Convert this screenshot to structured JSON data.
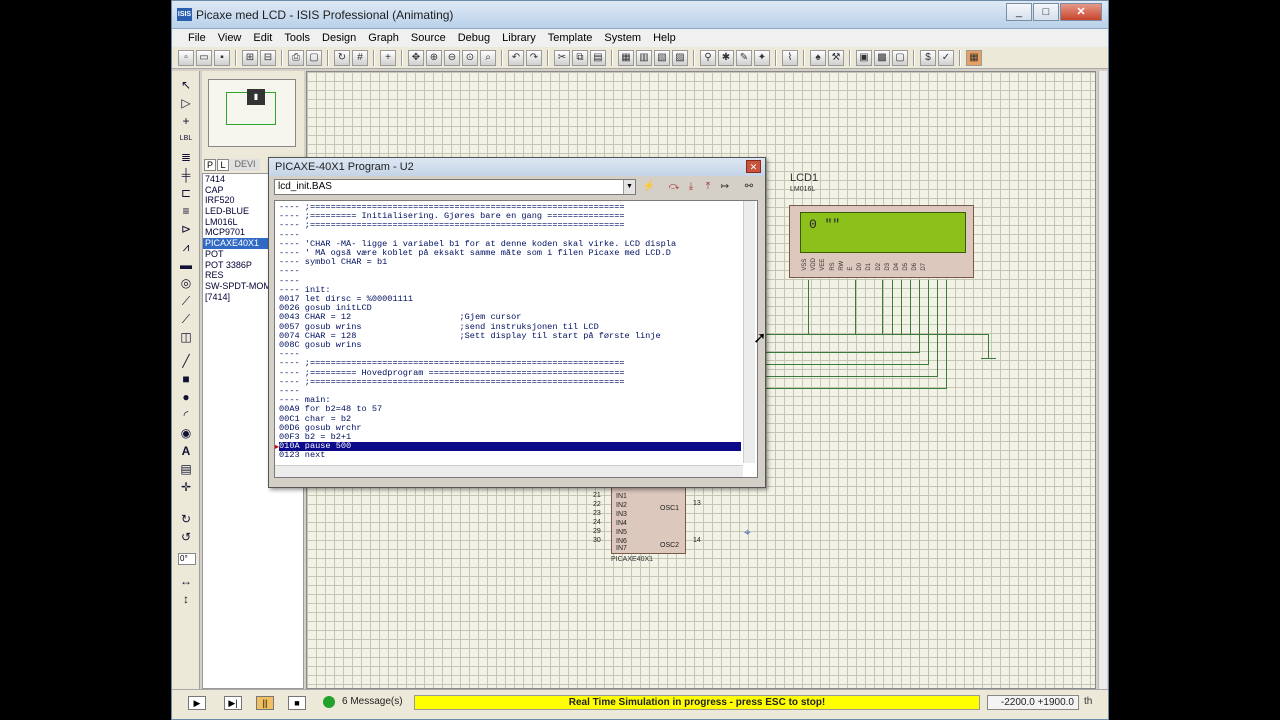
{
  "window": {
    "title": "Picaxe med LCD - ISIS Professional (Animating)",
    "icon": "ISIS"
  },
  "window_buttons": {
    "minimize": "_",
    "maximize": "□",
    "close": "✕"
  },
  "menu": [
    "File",
    "View",
    "Edit",
    "Tools",
    "Design",
    "Graph",
    "Source",
    "Debug",
    "Library",
    "Template",
    "System",
    "Help"
  ],
  "device_panel": {
    "tab_p": "P",
    "tab_l": "L",
    "header": "DEVI",
    "devices": [
      "7414",
      "CAP",
      "IRF520",
      "LED-BLUE",
      "LM016L",
      "MCP9701",
      "PICAXE40X1",
      "POT",
      "POT 3386P",
      "RES",
      "SW-SPDT-MOM",
      "[7414]"
    ],
    "selected": "PICAXE40X1"
  },
  "rotation_field": "0°",
  "program_window": {
    "title": "PICAXE-40X1 Program - U2",
    "file": "lcd_init.BAS",
    "code_lines": [
      "---- ;=============================================================",
      "---- ;========= Initialisering. Gjøres bare en gang ===============",
      "---- ;=============================================================",
      "----",
      "---- 'CHAR -MÅ- ligge i variabel b1 for at denne koden skal virke. LCD displa",
      "---- ' MÅ også være koblet på eksakt samme måte som i filen Picaxe med LCD.D",
      "---- symbol CHAR = b1",
      "----",
      "----",
      "---- init:",
      "0017 let dirsc = %00001111",
      "0026 gosub initLCD",
      "0043 CHAR = 12                     ;Gjem cursor",
      "0057 gosub wrins                   ;send instruksjonen til LCD",
      "0074 CHAR = 128                    ;Sett display til start på første linje",
      "008C gosub wrins",
      "----",
      "---- ;=============================================================",
      "---- ;========= Hovedprogram ======================================",
      "---- ;=============================================================",
      "----",
      "---- main:",
      "00A9 for b2=48 to 57",
      "00C1 char = b2",
      "00D6 gosub wrchr",
      "00F3 b2 = b2+1",
      "010A pause 500",
      "0123 next"
    ],
    "highlighted_line": 26
  },
  "lcd": {
    "label": "LCD1",
    "model": "LM016L",
    "display_text": "0 \"\"",
    "pins": [
      "VSS",
      "VDD",
      "VEE",
      "RS",
      "RW",
      "E",
      "D0",
      "D1",
      "D2",
      "D3",
      "D4",
      "D5",
      "D6",
      "D7"
    ]
  },
  "pic": {
    "label": "PICAXE40X1",
    "pin_numbers": [
      "21",
      "22",
      "23",
      "24",
      "29",
      "30",
      "13",
      "14"
    ],
    "inputs": [
      "IN1",
      "IN2",
      "IN3",
      "IN4",
      "IN5",
      "IN6",
      "IN7"
    ],
    "osc1": "OSC1",
    "osc2": "OSC2"
  },
  "status": {
    "messages": "6 Message(s)",
    "simulation": "Real Time Simulation in progress - press ESC to stop!",
    "coordinates": "-2200.0  +1900.0",
    "unit": "th"
  }
}
